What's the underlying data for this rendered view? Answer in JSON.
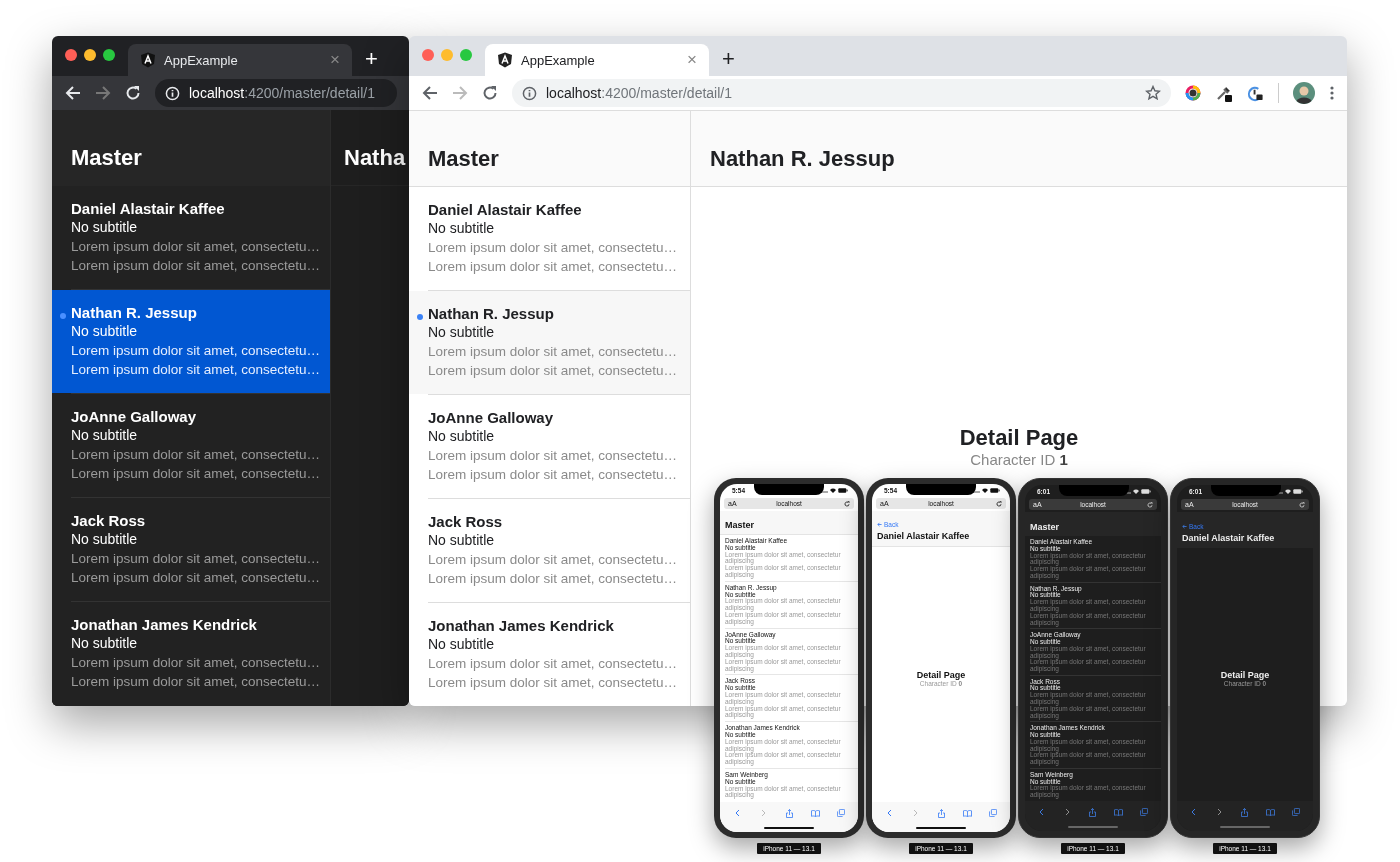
{
  "browser_windows": [
    {
      "dark": true,
      "show_extensions": false,
      "tab": {
        "title": "AppExample",
        "close": "×"
      },
      "new_tab": "+",
      "url": {
        "host": "localhost",
        "path": ":4200/master/detail/1"
      },
      "master": {
        "title": "Master",
        "items": [
          {
            "name": "Daniel Alastair Kaffee",
            "subtitle": "No subtitle",
            "lines": [
              "Lorem ipsum dolor sit amet, consectetu…",
              "Lorem ipsum dolor sit amet, consectetu…"
            ],
            "selected": false
          },
          {
            "name": "Nathan R. Jessup",
            "subtitle": "No subtitle",
            "lines": [
              "Lorem ipsum dolor sit amet, consectetu…",
              "Lorem ipsum dolor sit amet, consectetu…"
            ],
            "selected": true
          },
          {
            "name": "JoAnne Galloway",
            "subtitle": "No subtitle",
            "lines": [
              "Lorem ipsum dolor sit amet, consectetu…",
              "Lorem ipsum dolor sit amet, consectetu…"
            ],
            "selected": false
          },
          {
            "name": "Jack Ross",
            "subtitle": "No subtitle",
            "lines": [
              "Lorem ipsum dolor sit amet, consectetu…",
              "Lorem ipsum dolor sit amet, consectetu…"
            ],
            "selected": false
          },
          {
            "name": "Jonathan James Kendrick",
            "subtitle": "No subtitle",
            "lines": [
              "Lorem ipsum dolor sit amet, consectetu…",
              "Lorem ipsum dolor sit amet, consectetu…"
            ],
            "selected": false
          }
        ]
      },
      "detail": {
        "title": "Natha"
      }
    },
    {
      "dark": false,
      "show_extensions": true,
      "tab": {
        "title": "AppExample",
        "close": "×"
      },
      "new_tab": "+",
      "url": {
        "host": "localhost",
        "path": ":4200/master/detail/1"
      },
      "master": {
        "title": "Master",
        "items": [
          {
            "name": "Daniel Alastair Kaffee",
            "subtitle": "No subtitle",
            "lines": [
              "Lorem ipsum dolor sit amet, consectetu…",
              "Lorem ipsum dolor sit amet, consectetu…"
            ],
            "selected": false
          },
          {
            "name": "Nathan R. Jessup",
            "subtitle": "No subtitle",
            "lines": [
              "Lorem ipsum dolor sit amet, consectetu…",
              "Lorem ipsum dolor sit amet, consectetu…"
            ],
            "selected": true
          },
          {
            "name": "JoAnne Galloway",
            "subtitle": "No subtitle",
            "lines": [
              "Lorem ipsum dolor sit amet, consectetu…",
              "Lorem ipsum dolor sit amet, consectetu…"
            ],
            "selected": false
          },
          {
            "name": "Jack Ross",
            "subtitle": "No subtitle",
            "lines": [
              "Lorem ipsum dolor sit amet, consectetu…",
              "Lorem ipsum dolor sit amet, consectetu…"
            ],
            "selected": false
          },
          {
            "name": "Jonathan James Kendrick",
            "subtitle": "No subtitle",
            "lines": [
              "Lorem ipsum dolor sit amet, consectetu…",
              "Lorem ipsum dolor sit amet, consectetu…"
            ],
            "selected": false
          }
        ]
      },
      "detail": {
        "title": "Nathan R. Jessup",
        "heading": "Detail Page",
        "caption": "Character ID **1**"
      }
    }
  ],
  "phones": [
    {
      "dark": false,
      "kind": "master",
      "time": "5:54",
      "text_size": "aA",
      "address": "localhost",
      "title": "Master",
      "items": [
        {
          "name": "Daniel Alastair Kaffee",
          "subtitle": "No subtitle",
          "lines": [
            "Lorem ipsum dolor sit amet, consectetur adipiscing",
            "Lorem ipsum dolor sit amet, consectetur adipiscing"
          ]
        },
        {
          "name": "Nathan R. Jessup",
          "subtitle": "No subtitle",
          "lines": [
            "Lorem ipsum dolor sit amet, consectetur adipiscing",
            "Lorem ipsum dolor sit amet, consectetur adipiscing"
          ]
        },
        {
          "name": "JoAnne Galloway",
          "subtitle": "No subtitle",
          "lines": [
            "Lorem ipsum dolor sit amet, consectetur adipiscing",
            "Lorem ipsum dolor sit amet, consectetur adipiscing"
          ]
        },
        {
          "name": "Jack Ross",
          "subtitle": "No subtitle",
          "lines": [
            "Lorem ipsum dolor sit amet, consectetur adipiscing",
            "Lorem ipsum dolor sit amet, consectetur adipiscing"
          ]
        },
        {
          "name": "Jonathan James Kendrick",
          "subtitle": "No subtitle",
          "lines": [
            "Lorem ipsum dolor sit amet, consectetur adipiscing",
            "Lorem ipsum dolor sit amet, consectetur adipiscing"
          ]
        },
        {
          "name": "Sam Weinberg",
          "subtitle": "No subtitle",
          "lines": [
            "Lorem ipsum dolor sit amet, consectetur adipiscing"
          ]
        }
      ],
      "label": "iPhone 11 — 13.1"
    },
    {
      "dark": false,
      "kind": "detail",
      "time": "5:54",
      "text_size": "aA",
      "address": "localhost",
      "back": "Back",
      "title": "Daniel Alastair Kaffee",
      "heading": "Detail Page",
      "caption": "Character ID **0**",
      "label": "iPhone 11 — 13.1"
    },
    {
      "dark": true,
      "kind": "master",
      "time": "6:01",
      "text_size": "aA",
      "address": "localhost",
      "title": "Master",
      "items": [
        {
          "name": "Daniel Alastair Kaffee",
          "subtitle": "No subtitle",
          "lines": [
            "Lorem ipsum dolor sit amet, consectetur adipiscing",
            "Lorem ipsum dolor sit amet, consectetur adipiscing"
          ]
        },
        {
          "name": "Nathan R. Jessup",
          "subtitle": "No subtitle",
          "lines": [
            "Lorem ipsum dolor sit amet, consectetur adipiscing",
            "Lorem ipsum dolor sit amet, consectetur adipiscing"
          ]
        },
        {
          "name": "JoAnne Galloway",
          "subtitle": "No subtitle",
          "lines": [
            "Lorem ipsum dolor sit amet, consectetur adipiscing",
            "Lorem ipsum dolor sit amet, consectetur adipiscing"
          ]
        },
        {
          "name": "Jack Ross",
          "subtitle": "No subtitle",
          "lines": [
            "Lorem ipsum dolor sit amet, consectetur adipiscing",
            "Lorem ipsum dolor sit amet, consectetur adipiscing"
          ]
        },
        {
          "name": "Jonathan James Kendrick",
          "subtitle": "No subtitle",
          "lines": [
            "Lorem ipsum dolor sit amet, consectetur adipiscing",
            "Lorem ipsum dolor sit amet, consectetur adipiscing"
          ]
        },
        {
          "name": "Sam Weinberg",
          "subtitle": "No subtitle",
          "lines": [
            "Lorem ipsum dolor sit amet, consectetur adipiscing"
          ]
        }
      ],
      "label": "iPhone 11 — 13.1"
    },
    {
      "dark": true,
      "kind": "detail",
      "time": "6:01",
      "text_size": "aA",
      "address": "localhost",
      "back": "Back",
      "title": "Daniel Alastair Kaffee",
      "heading": "Detail Page",
      "caption": "Character ID **0**",
      "label": "iPhone 11 — 13.1"
    }
  ]
}
